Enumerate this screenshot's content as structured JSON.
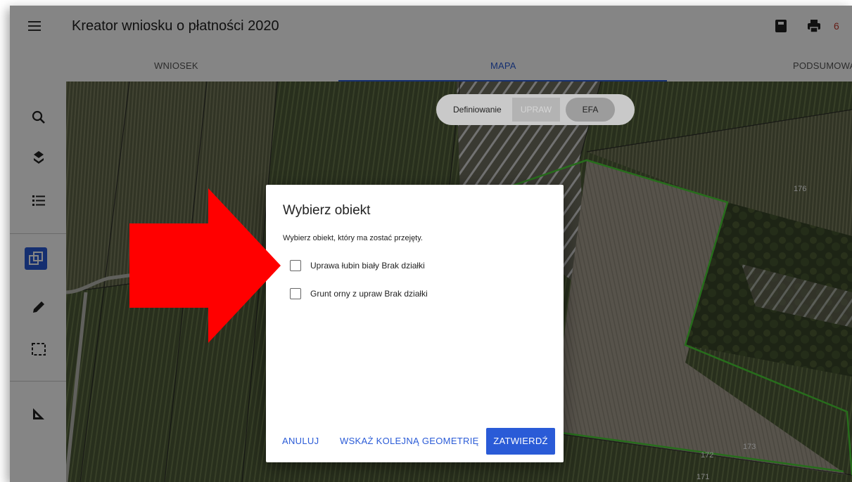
{
  "header": {
    "title": "Kreator wniosku o płatności 2020",
    "counter": "6"
  },
  "tabs": [
    {
      "label": "WNIOSEK"
    },
    {
      "label": "MAPA"
    },
    {
      "label": "PODSUMOWANIE"
    }
  ],
  "active_tab": "MAPA",
  "toolbar": {
    "icons": [
      "search-icon",
      "layers-icon",
      "list-icon",
      "draw-geometry-icon",
      "pencil-icon",
      "selection-icon",
      "measure-icon"
    ]
  },
  "mode_toggle": {
    "label": "Definiowanie",
    "upraw": "UPRAW",
    "efa": "EFA"
  },
  "map_labels": {
    "parcel_176": "176",
    "parcel_173": "173",
    "parcel_172": "172",
    "parcel_171": "171"
  },
  "dialog": {
    "title": "Wybierz obiekt",
    "subtitle": "Wybierz obiekt, który ma zostać przejęty.",
    "options": [
      {
        "label": "Uprawa łubin biały Brak działki",
        "checked": false
      },
      {
        "label": "Grunt orny z upraw Brak działki",
        "checked": false
      }
    ],
    "buttons": {
      "cancel": "ANULUJ",
      "next": "WSKAŻ KOLEJNĄ GEOMETRIĘ",
      "confirm": "ZATWIERDŹ"
    }
  },
  "colors": {
    "accent": "#2a5bd7",
    "parcel_outline": "#4cd137",
    "arrow": "#ff0000"
  }
}
